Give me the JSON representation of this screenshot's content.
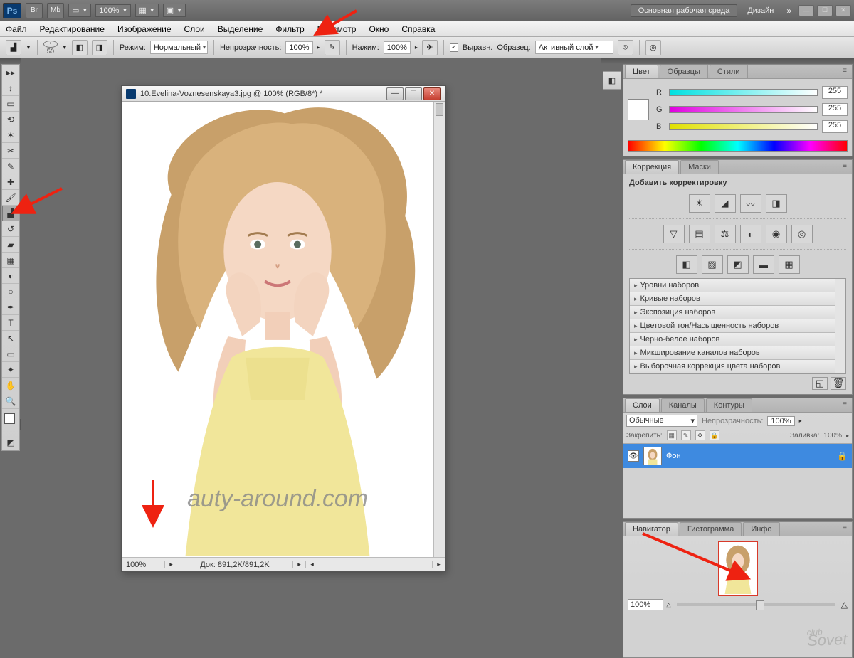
{
  "top": {
    "ps": "Ps",
    "zoom": "100%",
    "workspace_main": "Основная рабочая среда",
    "workspace_design": "Дизайн"
  },
  "menu": {
    "file": "Файл",
    "edit": "Редактирование",
    "image": "Изображение",
    "layers": "Слои",
    "select": "Выделение",
    "filter": "Фильтр",
    "view": "Просмотр",
    "window": "Окно",
    "help": "Справка"
  },
  "options": {
    "brush_size": "50",
    "mode_label": "Режим:",
    "mode_value": "Нормальный",
    "opacity_label": "Непрозрачность:",
    "opacity_value": "100%",
    "flow_label": "Нажим:",
    "flow_value": "100%",
    "aligned_label": "Выравн.",
    "sample_label": "Образец:",
    "sample_value": "Активный слой"
  },
  "document": {
    "title": "10.Evelina-Voznesenskaya3.jpg @ 100% (RGB/8*) *",
    "zoom": "100%",
    "dimensions": "Док: 891,2K/891,2K",
    "watermark": "auty-around.com"
  },
  "panels": {
    "color": {
      "tab_color": "Цвет",
      "tab_swatches": "Образцы",
      "tab_styles": "Стили",
      "r_label": "R",
      "r_value": "255",
      "g_label": "G",
      "g_value": "255",
      "b_label": "B",
      "b_value": "255"
    },
    "adjust": {
      "tab_correction": "Коррекция",
      "tab_masks": "Маски",
      "add_label": "Добавить корректировку",
      "presets": [
        "Уровни наборов",
        "Кривые наборов",
        "Экспозиция наборов",
        "Цветовой тон/Насыщенность наборов",
        "Черно-белое наборов",
        "Микширование каналов наборов",
        "Выборочная коррекция цвета наборов"
      ]
    },
    "layers": {
      "tab_layers": "Слои",
      "tab_channels": "Каналы",
      "tab_paths": "Контуры",
      "blend_mode": "Обычные",
      "opacity_label": "Непрозрачность:",
      "opacity_value": "100%",
      "lock_label": "Закрепить:",
      "fill_label": "Заливка:",
      "fill_value": "100%",
      "layer_name": "Фон"
    },
    "navigator": {
      "tab_nav": "Навигатор",
      "tab_hist": "Гистограмма",
      "tab_info": "Инфо",
      "zoom": "100%"
    }
  },
  "watermark_sovet": "Sovet"
}
